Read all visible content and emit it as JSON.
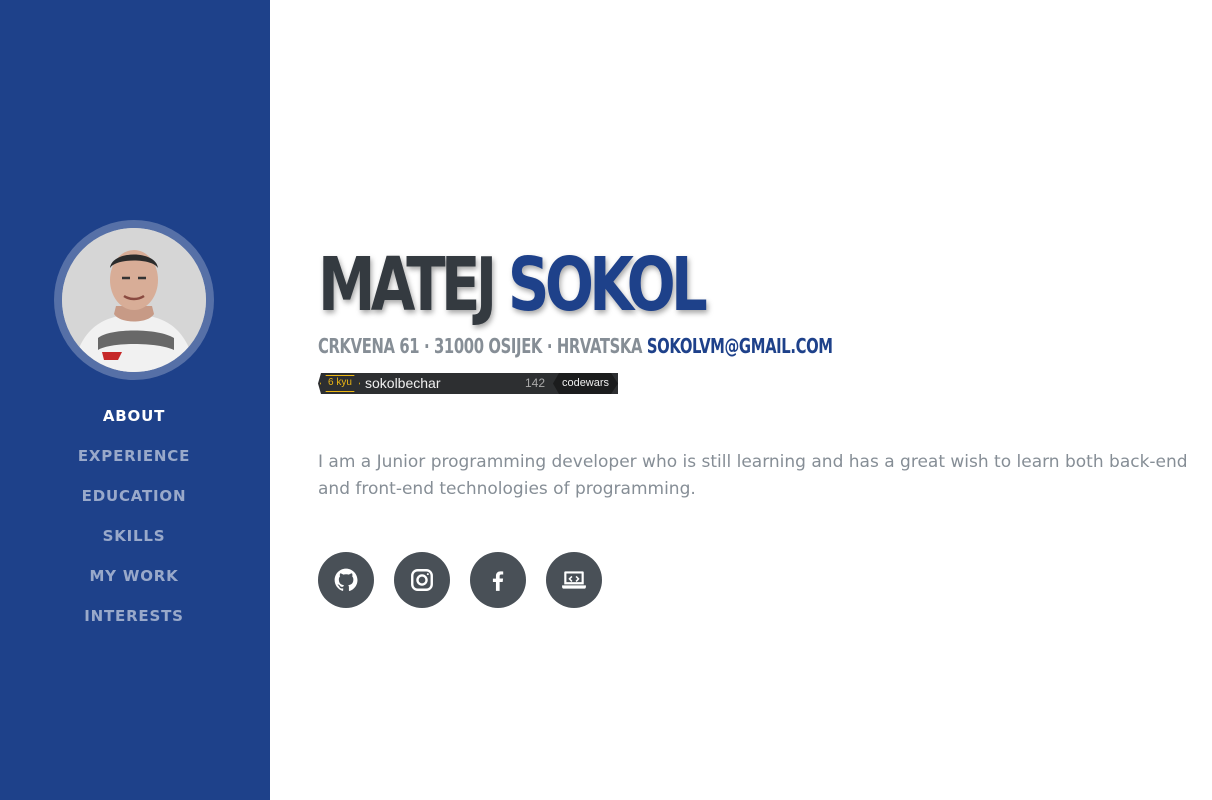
{
  "profile": {
    "first_name": "MATEJ",
    "last_name": "SOKOL",
    "address": "CRKVENA 61 · 31000 OSIJEK · HRVATSKA",
    "email": "SOKOLVM@GMAIL.COM",
    "bio": "I am a Junior programming developer who is still learning and has a great wish to learn both back-end and front-end technologies of programming."
  },
  "nav": {
    "items": [
      {
        "label": "ABOUT",
        "active": true
      },
      {
        "label": "EXPERIENCE",
        "active": false
      },
      {
        "label": "EDUCATION",
        "active": false
      },
      {
        "label": "SKILLS",
        "active": false
      },
      {
        "label": "MY WORK",
        "active": false
      },
      {
        "label": "INTERESTS",
        "active": false
      }
    ]
  },
  "codewars_badge": {
    "rank": "6 kyu",
    "username": "sokolbechar",
    "honor": "142",
    "brand": "codewars"
  },
  "socials": [
    {
      "name": "github-icon"
    },
    {
      "name": "instagram-icon"
    },
    {
      "name": "facebook-icon"
    },
    {
      "name": "laptop-code-icon"
    }
  ],
  "colors": {
    "primary": "#1e418a",
    "heading": "#343a40",
    "muted": "#868e96",
    "social_bg": "#495057",
    "badge_gold": "#ecb613"
  }
}
